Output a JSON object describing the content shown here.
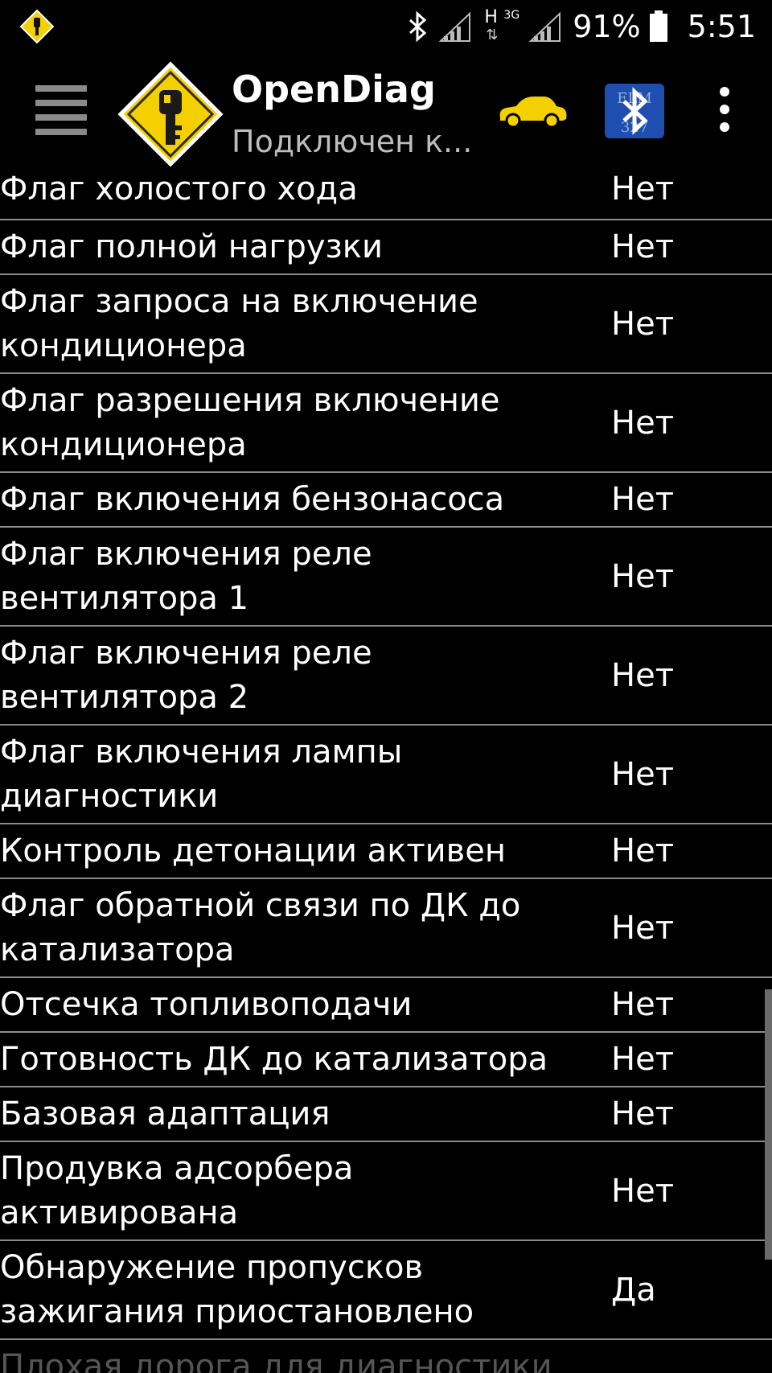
{
  "status_bar": {
    "h_label": "H",
    "net_label": "3G",
    "battery": "91%",
    "time": "5:51"
  },
  "app_bar": {
    "title": "OpenDiag",
    "subtitle": "Подключен к...",
    "elm_text": "ELM 327"
  },
  "icons": {
    "menu": "hamburger-menu-icon",
    "logo": "opendiag-key-logo",
    "car": "car-icon",
    "elm": "elm327-bluetooth-icon",
    "more": "more-vert-icon",
    "accent_yellow": "#f5d000"
  },
  "rows": [
    {
      "label": "Флаг холостого хода",
      "value": "Нет"
    },
    {
      "label": "Флаг полной нагрузки",
      "value": "Нет"
    },
    {
      "label": "Флаг запроса на включение\nкондиционера",
      "value": "Нет"
    },
    {
      "label": "Флаг разрешения включение\nкондиционера",
      "value": "Нет"
    },
    {
      "label": "Флаг включения бензонасоса",
      "value": "Нет"
    },
    {
      "label": "Флаг включения реле\nвентилятора 1",
      "value": "Нет"
    },
    {
      "label": "Флаг включения реле\nвентилятора 2",
      "value": "Нет"
    },
    {
      "label": "Флаг включения лампы\nдиагностики",
      "value": "Нет"
    },
    {
      "label": "Контроль детонации активен",
      "value": "Нет"
    },
    {
      "label": "Флаг обратной связи по ДК до\nкатализатора",
      "value": "Нет"
    },
    {
      "label": "Отсечка топливоподачи",
      "value": "Нет"
    },
    {
      "label": "Готовность ДК до катализатора",
      "value": "Нет"
    },
    {
      "label": "Базовая адаптация",
      "value": "Нет"
    },
    {
      "label": "Продувка адсорбера\nактивирована",
      "value": "Нет"
    },
    {
      "label": "Обнаружение пропусков\nзажигания приостановлено",
      "value": "Да"
    },
    {
      "label": "Плохая дорога для диагностики",
      "value": ""
    }
  ]
}
